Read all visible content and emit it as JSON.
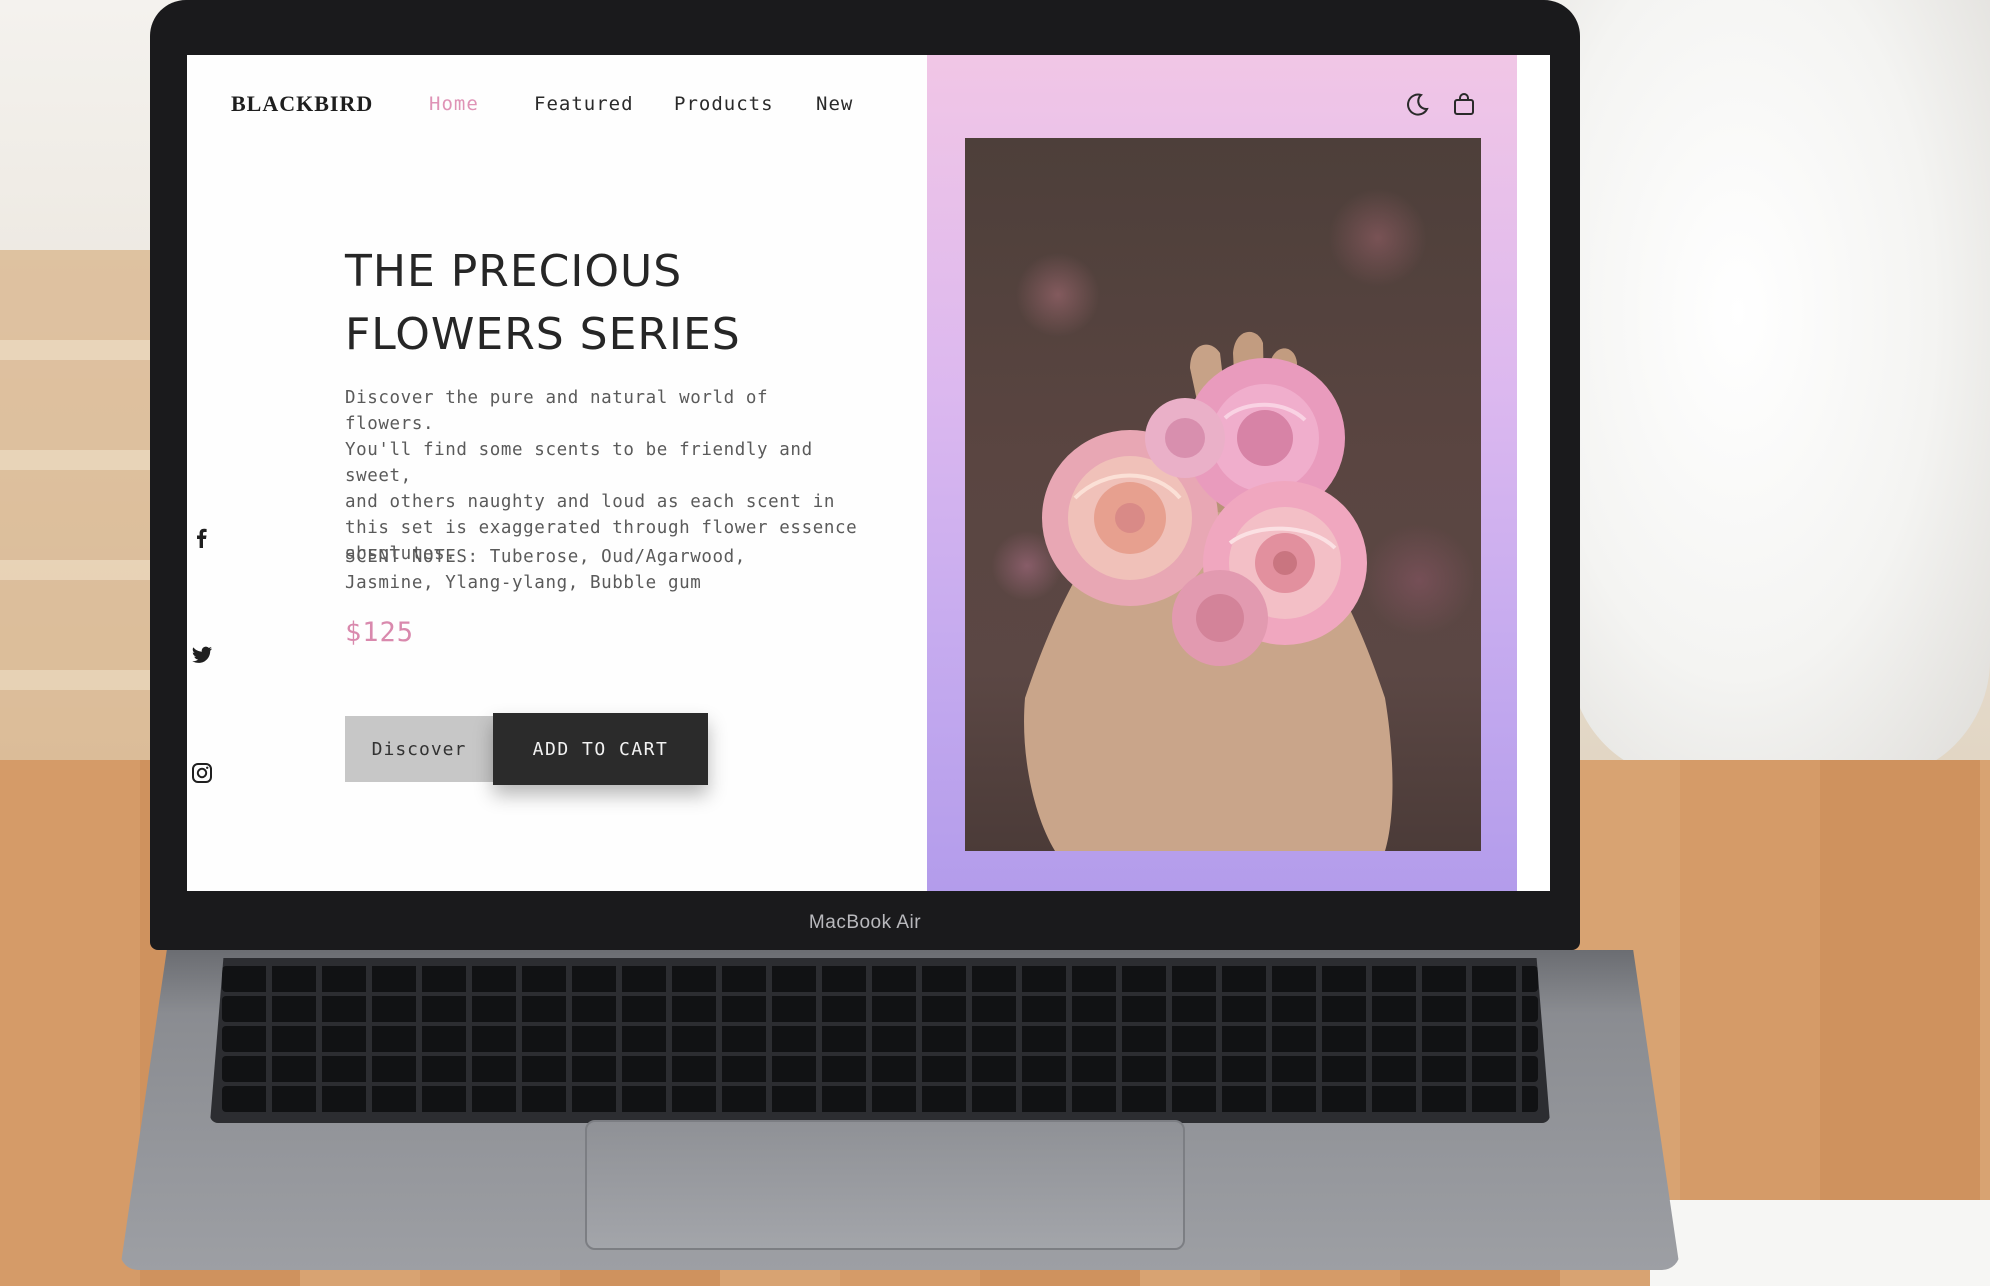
{
  "device": {
    "brand_label": "MacBook Air"
  },
  "site": {
    "logo": "BLACKBIRD",
    "nav": [
      {
        "label": "Home",
        "active": true
      },
      {
        "label": "Featured",
        "active": false
      },
      {
        "label": "Products",
        "active": false
      },
      {
        "label": "New",
        "active": false
      }
    ],
    "header_icons": [
      "moon-icon",
      "shopping-bag-icon"
    ]
  },
  "hero": {
    "title_line1": "THE PRECIOUS",
    "title_line2": "FLOWERS SERIES",
    "description": [
      "Discover the pure and natural world of flowers.",
      "You'll find some scents to be friendly and sweet,",
      "and others naughty and loud as each scent in",
      "this set is exaggerated through flower essence",
      "absolutes."
    ],
    "scent_notes": [
      "SCENT NOTES: Tuberose, Oud/Agarwood,",
      "Jasmine, Ylang-ylang, Bubble gum"
    ],
    "price": "$125",
    "discover_label": "Discover",
    "cart_label": "ADD TO CART"
  },
  "social": [
    "facebook-icon",
    "twitter-icon",
    "instagram-icon"
  ],
  "colors": {
    "accent_pink": "#df93b6",
    "gradient_top": "#f1c6e6",
    "gradient_bottom": "#b39ceb",
    "button_dark": "#2b2b2b",
    "button_light": "#c7c7c7"
  }
}
